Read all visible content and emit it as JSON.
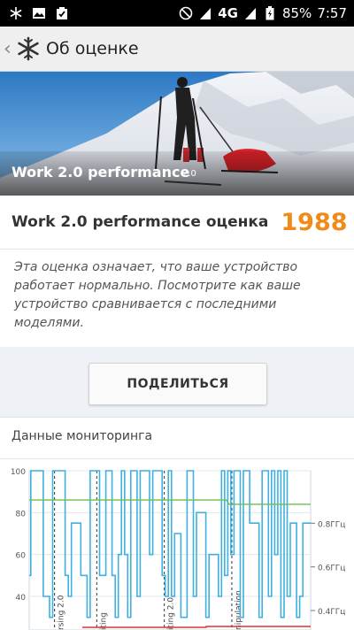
{
  "status_bar": {
    "left_icons": [
      "snowflake-icon",
      "image-icon",
      "clipboard-check-icon"
    ],
    "network": "4G",
    "battery": "85%",
    "time": "7:57"
  },
  "app_bar": {
    "title": "Об оценке"
  },
  "hero": {
    "title": "Work 2.0 performance",
    "version": "2.0"
  },
  "score": {
    "label": "Work 2.0 performance оценка",
    "value": "1988",
    "value_color": "#f08a18"
  },
  "description": "Эта оценка означает, что ваше устройство работает нормально. Посмотрите как ваше устройство сравнивается с последними моделями.",
  "share_button": "ПОДЕЛИТЬСЯ",
  "monitoring": {
    "title": "Данные мониторинга"
  },
  "chart_data": {
    "type": "line",
    "y_ticks_left": [
      "100",
      "80",
      "60",
      "40"
    ],
    "y_ticks_right": [
      "0.8ГГц",
      "0.6ГГц",
      "0.4ГГц"
    ],
    "ylim": [
      30,
      100
    ],
    "segment_labels": [
      "rsing 2.0",
      "iting",
      "iting 2.0",
      "nipulation"
    ],
    "segment_boundaries": [
      0.09,
      0.24,
      0.48,
      0.72
    ],
    "series": [
      {
        "color": "#3fb0e0",
        "values": [
          50,
          100,
          100,
          100,
          100,
          40,
          40,
          30,
          100,
          100,
          100,
          100,
          50,
          40,
          75,
          75,
          75,
          50,
          50,
          30,
          100,
          100,
          100,
          50,
          50,
          100,
          100,
          50,
          30,
          60,
          100,
          60,
          30,
          100,
          100,
          40,
          100,
          100,
          100,
          60,
          100,
          100,
          100,
          50,
          40,
          100,
          40,
          70,
          70,
          30,
          30,
          100,
          100,
          40,
          80,
          80,
          80,
          30,
          60,
          60,
          60,
          40,
          100,
          50,
          100,
          60,
          100,
          100,
          30,
          100,
          100,
          75,
          75,
          75,
          30,
          100,
          100,
          40,
          100,
          60,
          100,
          30,
          100,
          40,
          75,
          75,
          30,
          40,
          75,
          75,
          75
        ]
      },
      {
        "color": "#6dbf4a",
        "values": [
          86,
          86,
          86,
          86,
          86,
          86,
          86,
          86,
          86,
          86,
          86,
          86,
          86,
          86,
          86,
          86,
          86,
          86,
          86,
          86,
          86,
          86,
          86,
          86,
          86,
          86,
          86,
          86,
          86,
          86,
          86,
          86,
          86,
          86,
          86,
          86,
          86,
          86,
          86,
          86,
          86,
          86,
          86,
          86,
          86,
          86,
          86,
          86,
          86,
          86,
          86,
          86,
          86,
          86,
          86,
          86,
          86,
          86,
          86,
          86,
          86,
          86,
          86,
          86,
          84,
          84,
          84,
          84,
          84,
          84,
          84,
          84,
          84,
          84,
          84,
          84,
          84,
          84,
          84,
          84,
          84,
          84,
          84,
          84,
          84,
          84,
          84,
          84,
          84,
          84,
          84
        ]
      }
    ]
  }
}
